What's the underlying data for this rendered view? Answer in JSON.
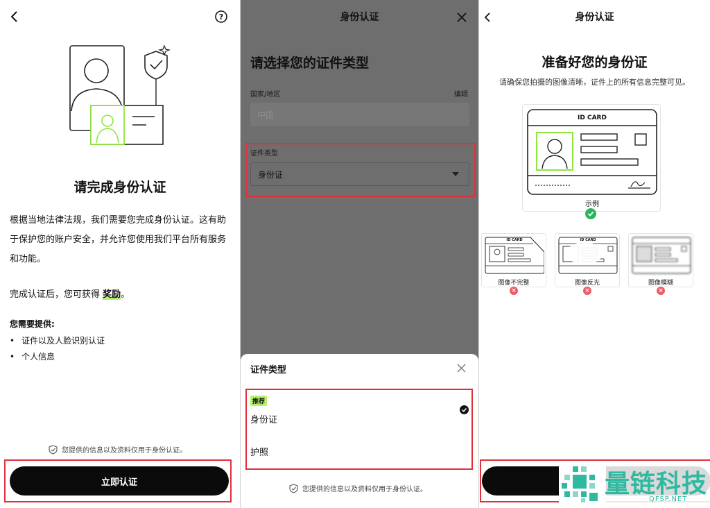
{
  "colors": {
    "accent_green": "#b6f36a",
    "highlight_red": "#e0303a",
    "brand_teal": "#2fb9a0",
    "error_red": "#f05a66",
    "success_green": "#2db55d"
  },
  "screen1": {
    "title": "请完成身份认证",
    "paragraph": "根据当地法律法规，我们需要您完成身份认证。这有助于保护您的账户安全，并允许您使用我们平台所有服务和功能。",
    "reward_prefix": "完成认证后，您可获得 ",
    "reward_highlight": "奖励",
    "reward_suffix": "。",
    "need_label": "您需要提供:",
    "need_items": [
      "证件以及人脸识别认证",
      "个人信息"
    ],
    "privacy": "您提供的信息以及资料仅用于身份认证。",
    "cta": "立即认证"
  },
  "screen2": {
    "header_title": "身份认证",
    "heading": "请选择您的证件类型",
    "country_label": "国家/地区",
    "edit_label": "编辑",
    "country_value": "中国",
    "doc_type_label": "证件类型",
    "doc_type_value": "身份证",
    "sheet": {
      "title": "证件类型",
      "recommended_badge": "推荐",
      "options": [
        "身份证",
        "护照"
      ],
      "privacy": "您提供的信息以及资料仅用于身份认证。"
    }
  },
  "screen3": {
    "header_title": "身份认证",
    "heading": "准备好您的身份证",
    "subtitle": "请确保您拍摄的图像清晰，证件上的所有信息完整可见。",
    "card_label": "ID CARD",
    "example_label": "示例",
    "bad_examples": [
      "图像不完整",
      "图像反光",
      "图像模糊"
    ]
  },
  "watermark": {
    "brand": "量链科技",
    "domain": "QFSP.NET"
  }
}
